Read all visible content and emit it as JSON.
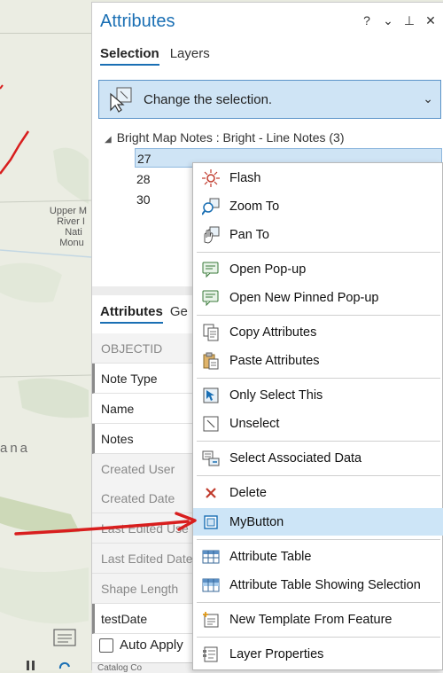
{
  "map": {
    "labels": [
      "Upper M",
      "River I",
      "Nati",
      "Monu"
    ],
    "label2": "ana"
  },
  "panel": {
    "title": "Attributes",
    "controls": [
      "?",
      "⌄",
      "⊥",
      "✕"
    ],
    "tabs": [
      "Selection",
      "Layers"
    ],
    "selection_bar_text": "Change the selection.",
    "tree": {
      "layer_label": "Bright Map Notes : Bright - Line Notes (3)",
      "items": [
        "27",
        "28",
        "30"
      ]
    },
    "attr_tabs": [
      "Attributes",
      "Ge"
    ],
    "fields": [
      "OBJECTID",
      "Note Type",
      "Name",
      "Notes",
      "Created User",
      "Created Date",
      "Last Edited Use",
      "Last Edited Date",
      "Shape Length",
      "testDate"
    ],
    "auto_apply_label": "Auto Apply",
    "bottom_strip_text": "Catalog  Co"
  },
  "context_menu": {
    "items": [
      {
        "label": "Flash",
        "icon": "flash-icon"
      },
      {
        "label": "Zoom To",
        "icon": "zoom-to-icon"
      },
      {
        "label": "Pan To",
        "icon": "pan-to-icon"
      },
      {
        "label": "Open Pop-up",
        "icon": "popup-icon"
      },
      {
        "label": "Open New Pinned Pop-up",
        "icon": "pinned-popup-icon"
      },
      {
        "label": "Copy Attributes",
        "icon": "copy-icon"
      },
      {
        "label": "Paste Attributes",
        "icon": "paste-icon"
      },
      {
        "label": "Only Select This",
        "icon": "select-this-icon"
      },
      {
        "label": "Unselect",
        "icon": "unselect-icon"
      },
      {
        "label": "Select Associated Data",
        "icon": "associated-data-icon"
      },
      {
        "label": "Delete",
        "icon": "delete-icon"
      },
      {
        "label": "MyButton",
        "icon": "mybutton-icon"
      },
      {
        "label": "Attribute Table",
        "icon": "table-icon"
      },
      {
        "label": "Attribute Table Showing Selection",
        "icon": "table-selection-icon"
      },
      {
        "label": "New Template From Feature",
        "icon": "template-icon"
      },
      {
        "label": "Layer Properties",
        "icon": "layer-properties-icon"
      }
    ],
    "highlighted": "MyButton"
  },
  "colors": {
    "accent": "#1a6fb4",
    "highlight": "#cde5f7",
    "annotation": "#d81e1e",
    "delete": "#c0392b"
  }
}
